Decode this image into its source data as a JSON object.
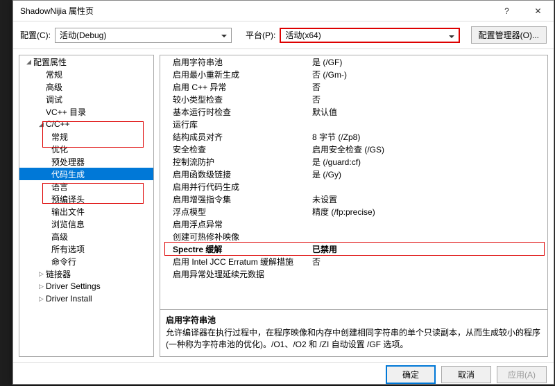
{
  "window": {
    "title": "ShadowNijia 属性页"
  },
  "configRow": {
    "configLabel": "配置(C):",
    "configValue": "活动(Debug)",
    "platformLabel": "平台(P):",
    "platformValue": "活动(x64)",
    "managerBtn": "配置管理器(O)..."
  },
  "tree": {
    "root": "配置属性",
    "items": [
      "常规",
      "高级",
      "调试",
      "VC++ 目录"
    ],
    "cpp": "C/C++",
    "cppItems": [
      "常规",
      "优化",
      "预处理器",
      "代码生成",
      "语言",
      "预编译头",
      "输出文件",
      "浏览信息",
      "高级",
      "所有选项",
      "命令行"
    ],
    "after": [
      "链接器",
      "Driver Settings",
      "Driver Install"
    ],
    "selectedIndex": 3
  },
  "grid": {
    "rows": [
      {
        "k": "启用字符串池",
        "v": "是 (/GF)"
      },
      {
        "k": "启用最小重新生成",
        "v": "否 (/Gm-)"
      },
      {
        "k": "启用 C++ 异常",
        "v": "否"
      },
      {
        "k": "较小类型检查",
        "v": "否"
      },
      {
        "k": "基本运行时检查",
        "v": "默认值"
      },
      {
        "k": "运行库",
        "v": ""
      },
      {
        "k": "结构成员对齐",
        "v": "8 字节 (/Zp8)"
      },
      {
        "k": "安全检查",
        "v": "启用安全检查 (/GS)"
      },
      {
        "k": "控制流防护",
        "v": "是 (/guard:cf)"
      },
      {
        "k": "启用函数级链接",
        "v": "是 (/Gy)"
      },
      {
        "k": "启用并行代码生成",
        "v": ""
      },
      {
        "k": "启用增强指令集",
        "v": "未设置"
      },
      {
        "k": "浮点模型",
        "v": "精度 (/fp:precise)"
      },
      {
        "k": "启用浮点异常",
        "v": ""
      },
      {
        "k": "创建可热修补映像",
        "v": ""
      },
      {
        "k": "Spectre 缓解",
        "v": "已禁用",
        "bold": true
      },
      {
        "k": "启用 Intel JCC Erratum 缓解措施",
        "v": "否"
      },
      {
        "k": "启用异常处理延续元数据",
        "v": ""
      }
    ]
  },
  "desc": {
    "title": "启用字符串池",
    "text": "允许编译器在执行过程中，在程序映像和内存中创建相同字符串的单个只读副本，从而生成较小的程序(一种称为字符串池的优化)。/O1、/O2 和 /ZI 自动设置 /GF 选项。"
  },
  "footer": {
    "ok": "确定",
    "cancel": "取消",
    "apply": "应用(A)"
  }
}
